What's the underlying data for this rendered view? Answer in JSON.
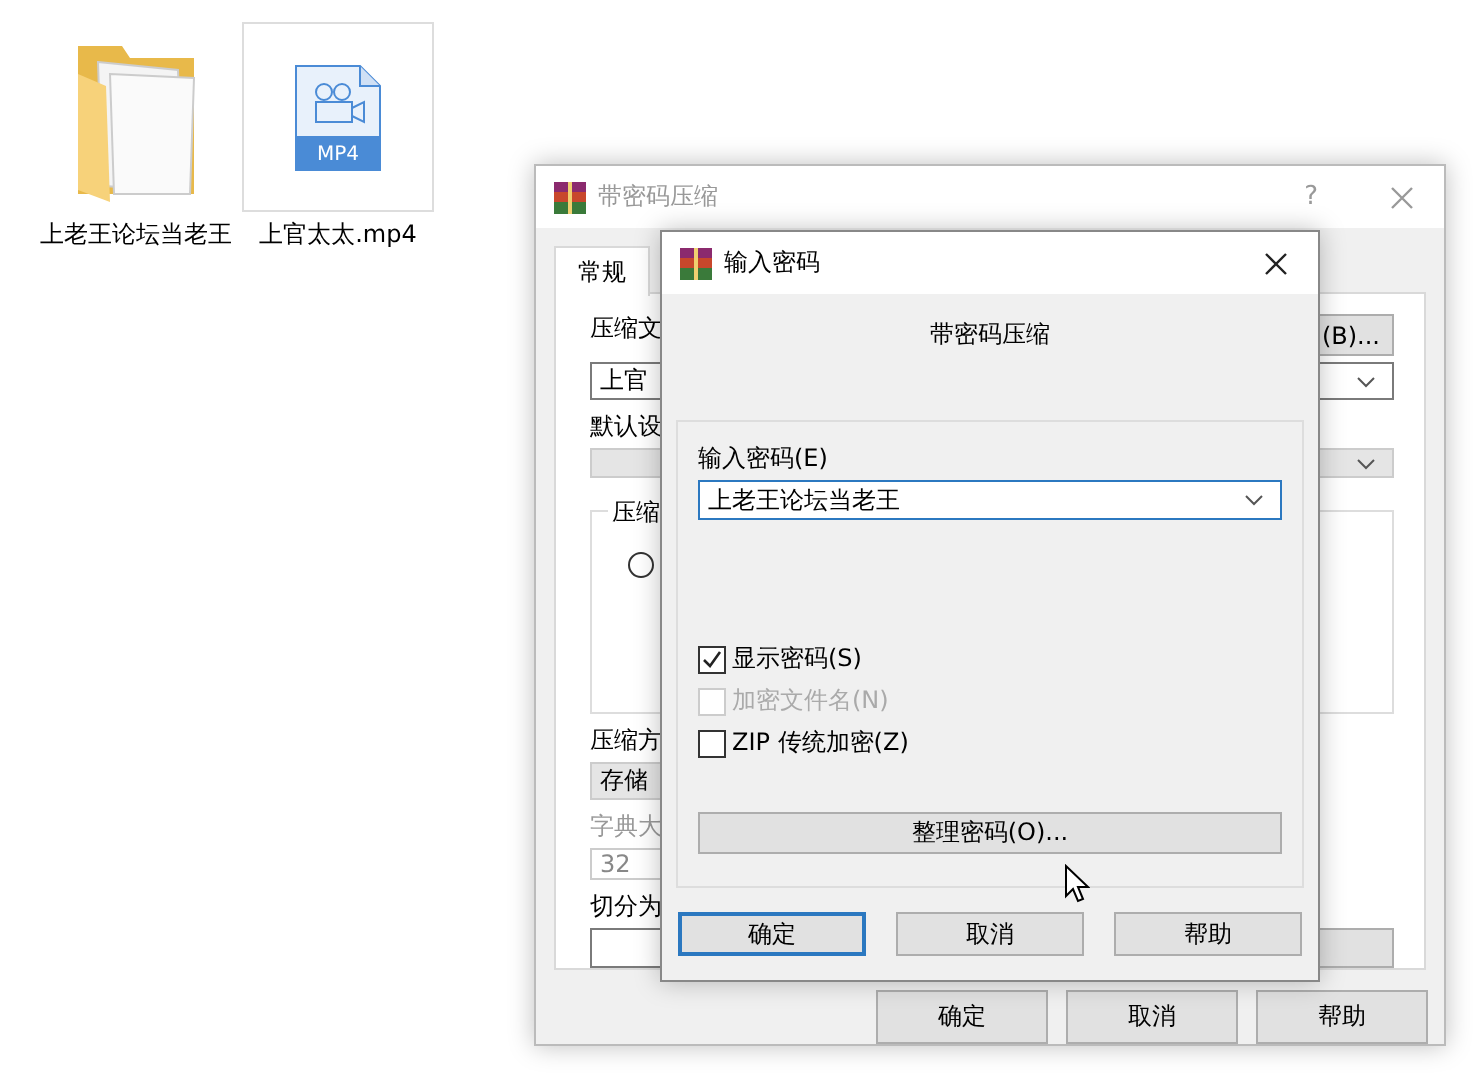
{
  "desktop": {
    "icons": [
      {
        "kind": "folder",
        "label": "上老王论坛当老王",
        "selected": false
      },
      {
        "kind": "video",
        "label": "上官太太.mp4",
        "badge": "MP4",
        "selected": true
      }
    ]
  },
  "back_window": {
    "title": "带密码压缩",
    "help": "?",
    "tabs": [
      {
        "label": "常规",
        "selected": true
      }
    ],
    "archive_label": "压缩文",
    "browse_button": "(B)...",
    "archive_value": "上官",
    "profile_label": "默认设",
    "group_label": "压缩",
    "radio": {
      "selected": false
    },
    "method_label": "压缩方",
    "method_value": "存储",
    "dict_label": "字典大",
    "dict_value": "32",
    "split_label": "切分为",
    "buttons": [
      "确定",
      "取消",
      "帮助"
    ]
  },
  "password_dialog": {
    "title": "输入密码",
    "heading": "带密码压缩",
    "password_label": "输入密码(E)",
    "password_value": "上老王论坛当老王",
    "options": [
      {
        "label": "显示密码(S)",
        "checked": true,
        "disabled": false
      },
      {
        "label": "加密文件名(N)",
        "checked": false,
        "disabled": true
      },
      {
        "label": "ZIP 传统加密(Z)",
        "checked": false,
        "disabled": false
      }
    ],
    "manage_button": "整理密码(O)...",
    "buttons": [
      {
        "label": "确定",
        "default": true
      },
      {
        "label": "取消",
        "default": false
      },
      {
        "label": "帮助",
        "default": false
      }
    ]
  }
}
